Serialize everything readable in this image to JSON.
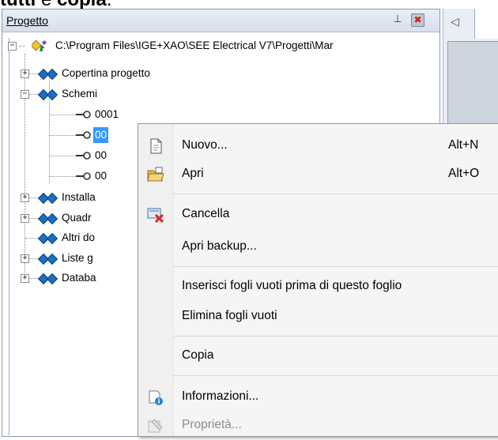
{
  "caption": {
    "bold1": "tutti",
    "mid": " e ",
    "bold2": "copia",
    "end": "."
  },
  "panel": {
    "title": "Progetto",
    "pin_glyph": "ᵖ",
    "close_glyph": "✖"
  },
  "tabs": {
    "left_arrow": "◁"
  },
  "tree": {
    "root": "C:\\Program Files\\IGE+XAO\\SEE Electrical V7\\Progetti\\Mar",
    "nodes": [
      {
        "label": "Copertina progetto",
        "expander": "+"
      },
      {
        "label": "Schemi",
        "expander": "−"
      },
      {
        "label": "0001"
      },
      {
        "label": "00"
      },
      {
        "label": "00"
      },
      {
        "label": "00"
      },
      {
        "label": "Installa",
        "expander": "+"
      },
      {
        "label": "Quadr",
        "expander": "+"
      },
      {
        "label": "Altri do"
      },
      {
        "label": "Liste g",
        "expander": "+"
      },
      {
        "label": "Databa",
        "expander": "+"
      }
    ]
  },
  "context_menu": {
    "items": [
      {
        "label": "Nuovo...",
        "shortcut": "Alt+N",
        "icon": "new-document-icon"
      },
      {
        "label": "Apri",
        "shortcut": "Alt+O",
        "icon": "open-folder-icon"
      },
      {
        "label": "Cancella",
        "icon": "delete-icon"
      },
      {
        "label": "Apri backup..."
      },
      {
        "label": "Inserisci fogli vuoti prima di questo foglio"
      },
      {
        "label": "Elimina fogli vuoti"
      },
      {
        "label": "Copia"
      },
      {
        "label": "Informazioni...",
        "icon": "info-icon"
      },
      {
        "label": "Proprietà...",
        "icon": "properties-icon",
        "disabled": true
      }
    ]
  },
  "colors": {
    "selection": "#3399ff",
    "diamond_blue": "#1a6fc4",
    "menu_bg": "#f5f5f5"
  }
}
